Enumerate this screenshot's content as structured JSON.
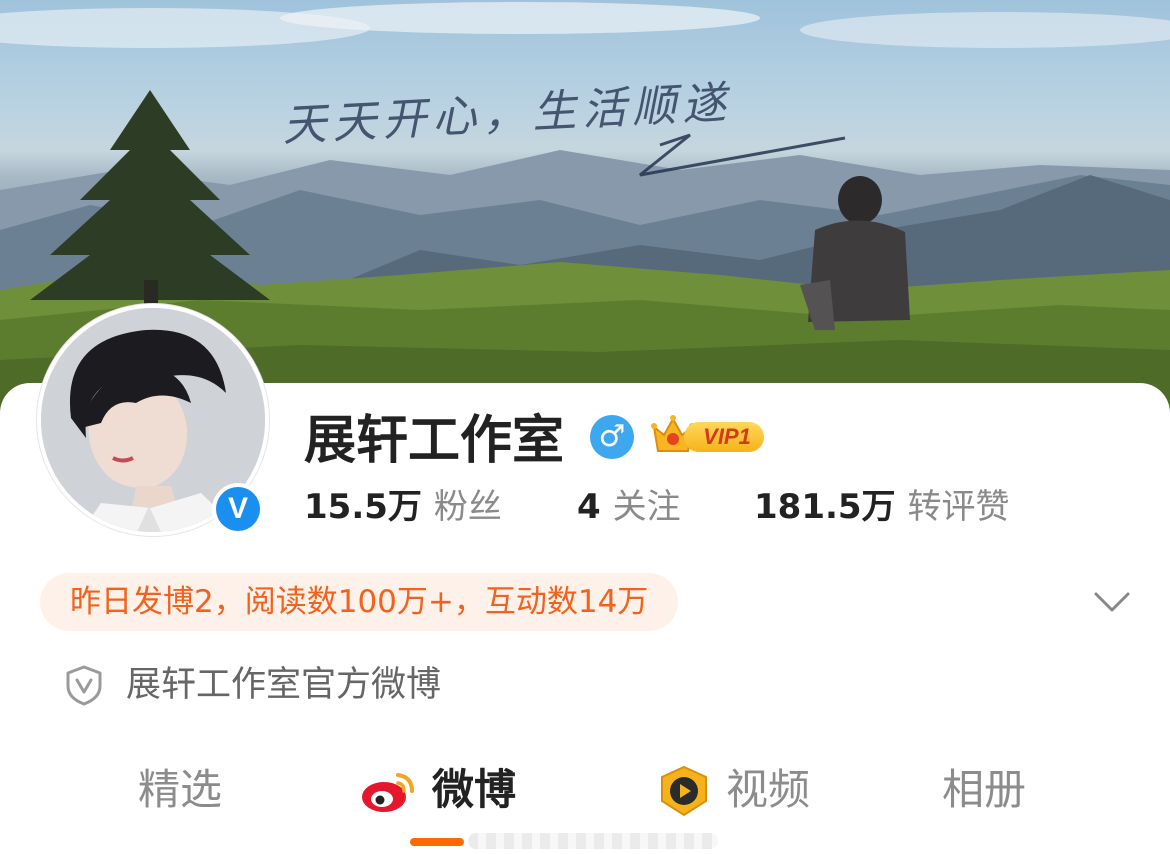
{
  "cover": {
    "caption": "天天开心，生活顺遂"
  },
  "profile": {
    "name": "展轩工作室",
    "verified_icon": "verified-v-icon",
    "gender_icon": "male-icon",
    "gender_symbol": "♂",
    "verified_symbol": "V",
    "vip_label": "VIP1",
    "stats": [
      {
        "value": "15.5万",
        "label": "粉丝"
      },
      {
        "value": "4",
        "label": "关注"
      },
      {
        "value": "181.5万",
        "label": "转评赞"
      }
    ],
    "highlight": "昨日发博2，阅读数100万+，互动数14万",
    "description": "展轩工作室官方微博"
  },
  "tabs": [
    {
      "label": "精选",
      "active": false
    },
    {
      "label": "微博",
      "active": true,
      "icon": "weibo-icon"
    },
    {
      "label": "视频",
      "active": false,
      "icon": "video-icon"
    },
    {
      "label": "相册",
      "active": false
    }
  ],
  "colors": {
    "accent": "#f2621d",
    "active_tab_underline": "#ff6a00",
    "verified_blue": "#1a8ff0",
    "highlight_bg": "#fdf1ea"
  }
}
